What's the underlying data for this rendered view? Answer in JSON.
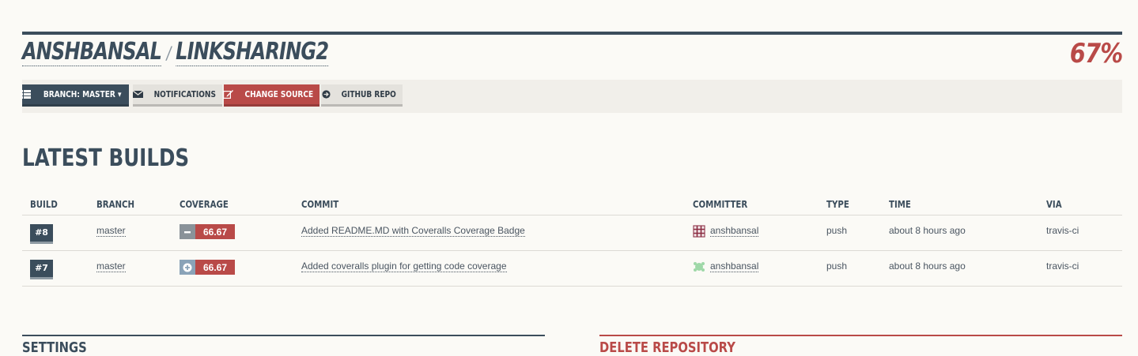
{
  "repo": {
    "owner": "ANSHBANSAL",
    "separator": "/",
    "name": "LINKSHARING2",
    "coverage": "67%"
  },
  "toolbar": {
    "branch_label": "BRANCH: MASTER ▾",
    "notifications_label": "NOTIFICATIONS",
    "change_source_label": "CHANGE SOURCE",
    "github_label": "GITHUB REPO"
  },
  "builds": {
    "title": "LATEST BUILDS",
    "columns": [
      "BUILD",
      "BRANCH",
      "COVERAGE",
      "COMMIT",
      "COMMITTER",
      "TYPE",
      "TIME",
      "VIA"
    ],
    "rows": [
      {
        "build": "#8",
        "branch": "master",
        "coverage": "66.67",
        "coverage_change": "minus-icon",
        "commit": "Added README.MD with Coveralls Coverage Badge",
        "committer": "anshbansal",
        "type": "push",
        "time": "about 8 hours ago",
        "via": "travis-ci"
      },
      {
        "build": "#7",
        "branch": "master",
        "coverage": "66.67",
        "coverage_change": "plus-icon",
        "commit": "Added coveralls plugin for getting code coverage",
        "committer": "anshbansal",
        "type": "push",
        "time": "about 8 hours ago",
        "via": "travis-ci"
      }
    ]
  },
  "sections": {
    "settings_title": "SETTINGS",
    "delete_title": "DELETE REPOSITORY"
  },
  "colors": {
    "primary": "#3b4d5c",
    "accent": "#b94a48",
    "background": "#fbfaf6"
  }
}
